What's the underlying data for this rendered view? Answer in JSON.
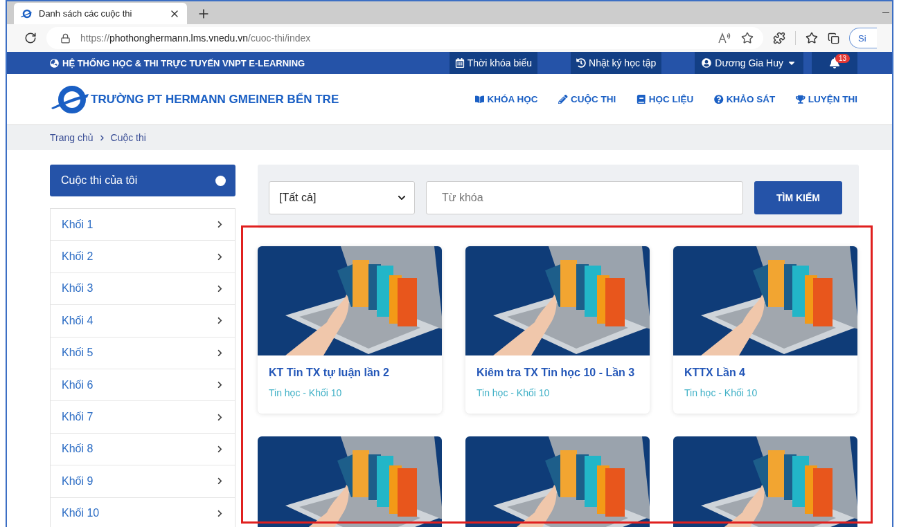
{
  "browser": {
    "tab_title": "Danh sách các cuộc thi",
    "url_scheme": "https://",
    "url_host": "phothonghermann.lms.vnedu.vn",
    "url_path": "/cuoc-thi/index",
    "profile_button": "Si"
  },
  "top_bar": {
    "title": "HỆ THỐNG HỌC & THI TRỰC TUYẾN VNPT E-LEARNING",
    "links": [
      {
        "kind": "calendar",
        "label": "Thời khóa biểu"
      },
      {
        "kind": "history",
        "label": "Nhật ký học tập"
      }
    ],
    "user": "Dương Gia Huy",
    "notifications": "13"
  },
  "header": {
    "school": "TRƯỜNG PT HERMANN GMEINER BẾN TRE",
    "nav": [
      {
        "kind": "book-open",
        "label": "KHÓA HỌC"
      },
      {
        "kind": "pencil",
        "label": "CUỘC THI"
      },
      {
        "kind": "book",
        "label": "HỌC LIỆU"
      },
      {
        "kind": "question",
        "label": "KHẢO SÁT"
      },
      {
        "kind": "trophy",
        "label": "LUYỆN THI"
      }
    ]
  },
  "breadcrumb": [
    "Trang chủ",
    "Cuộc thi"
  ],
  "sidebar": {
    "title": "Cuộc thi của tôi",
    "items": [
      "Khối 1",
      "Khối 2",
      "Khối 3",
      "Khối 4",
      "Khối 5",
      "Khối 6",
      "Khối 7",
      "Khối 8",
      "Khối 9",
      "Khối 10"
    ]
  },
  "filter": {
    "category": "[Tất cả]",
    "placeholder": "Từ khóa",
    "button": "TÌM KIẾM"
  },
  "contests": [
    {
      "kind": "full",
      "title": "KT Tin TX tự luận lần 2",
      "subtitle": "Tin học - Khối 10"
    },
    {
      "kind": "full",
      "title": "Kiêm tra TX Tin học 10 - Lần 3",
      "subtitle": "Tin học - Khối 10"
    },
    {
      "kind": "full",
      "title": "KTTX Lần 4",
      "subtitle": "Tin học - Khối 10"
    },
    {
      "kind": "image_only"
    },
    {
      "kind": "image_only"
    },
    {
      "kind": "image_only"
    }
  ]
}
